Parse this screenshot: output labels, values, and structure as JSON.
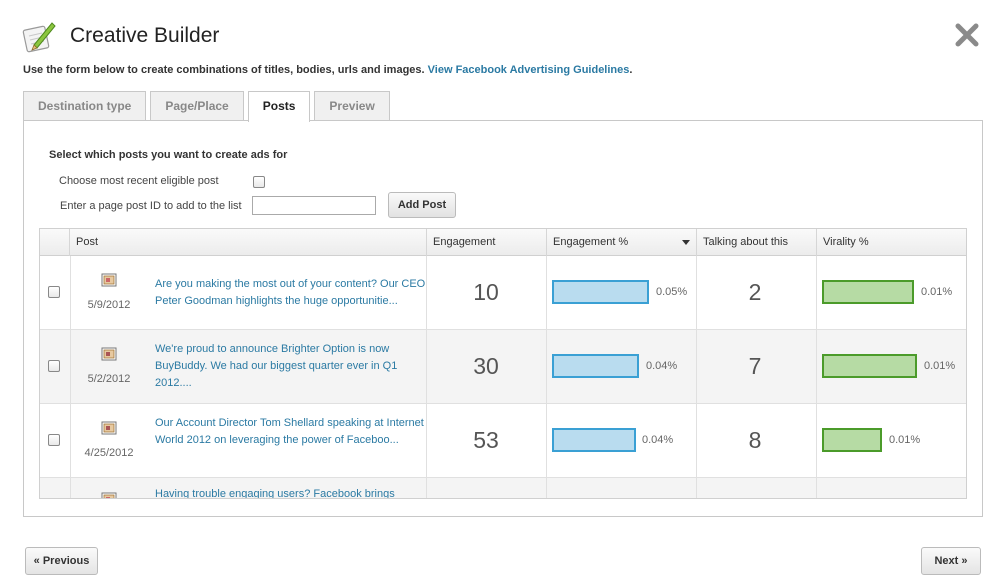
{
  "header": {
    "title": "Creative Builder",
    "subtitle": "Use the form below to create combinations of titles, bodies, urls and images.",
    "guidelines_link": "View Facebook Advertising Guidelines",
    "subtitle_end": "."
  },
  "tabs": [
    {
      "label": "Destination type",
      "active": false
    },
    {
      "label": "Page/Place",
      "active": false
    },
    {
      "label": "Posts",
      "active": true
    },
    {
      "label": "Preview",
      "active": false
    }
  ],
  "posts_panel": {
    "section_title": "Select which posts you want to create ads for",
    "recent_label": "Choose most recent eligible post",
    "post_id_label": "Enter a page post ID to add to the list",
    "post_id_value": "",
    "add_button": "Add Post"
  },
  "table": {
    "columns": [
      "Post",
      "Engagement",
      "Engagement %",
      "Talking about this",
      "Virality %"
    ],
    "rows": [
      {
        "date": "5/9/2012",
        "text": "Are you making the most out of your content? Our CEO Peter Goodman highlights the huge opportunitie...",
        "engagement": "10",
        "engagement_pct": "0.05%",
        "engagement_fill": 0.05,
        "talking": "2",
        "virality_pct": "0.01%",
        "virality_fill": 0.01
      },
      {
        "date": "5/2/2012",
        "text": "We're proud to announce Brighter Option is now BuyBuddy. We had our biggest quarter ever in Q1 2012....",
        "engagement": "30",
        "engagement_pct": "0.04%",
        "engagement_fill": 0.04,
        "talking": "7",
        "virality_pct": "0.01%",
        "virality_fill": 0.01
      },
      {
        "date": "4/25/2012",
        "text": "Our Account Director Tom Shellard speaking at Internet World 2012 on leveraging the power of Faceboo...",
        "engagement": "53",
        "engagement_pct": "0.04%",
        "engagement_fill": 0.04,
        "talking": "8",
        "virality_pct": "0.01%",
        "virality_fill": 0.01
      },
      {
        "date": "",
        "text": "Having trouble engaging users? Facebook brings",
        "engagement": "",
        "engagement_pct": "",
        "talking": "",
        "virality_pct": ""
      }
    ]
  },
  "footer": {
    "previous": "« Previous",
    "next": "Next »"
  },
  "colors": {
    "link": "#2b7aa3",
    "engagement_bar": "#b9dcef",
    "engagement_bar_border": "#3aa0d4",
    "virality_bar": "#b6dba4",
    "virality_bar_border": "#4b9b2a"
  },
  "icons": {
    "logo": "pencil-notepad-icon",
    "close": "close-icon",
    "post": "post-image-icon",
    "sort": "sort-down-icon"
  }
}
